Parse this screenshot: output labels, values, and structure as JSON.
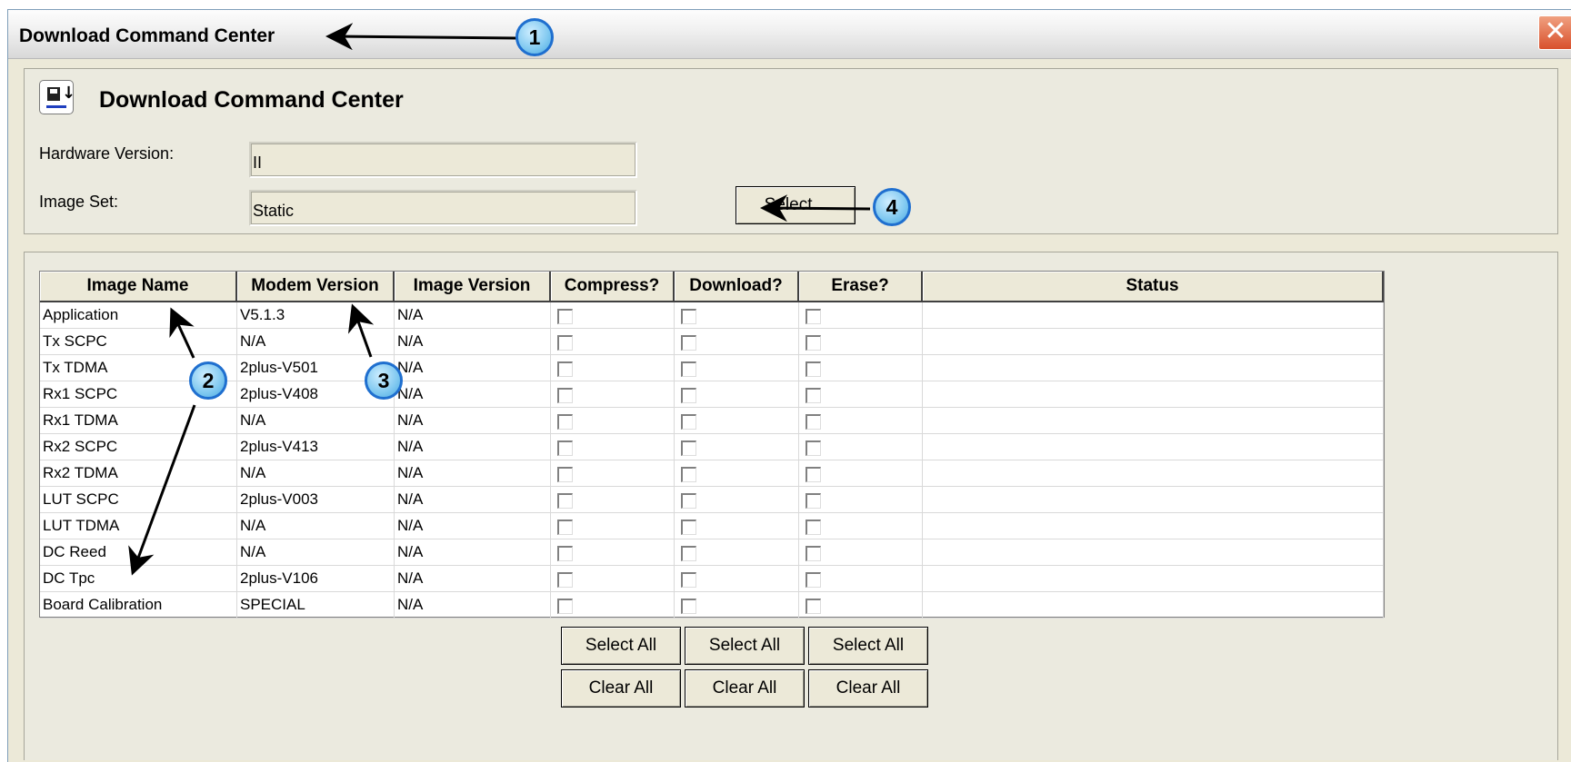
{
  "window": {
    "title": "Download Command Center",
    "close_glyph": "✕"
  },
  "header": {
    "title": "Download Command Center",
    "icon": "download-floppy-icon"
  },
  "hardware": {
    "label": "Hardware Version:",
    "value": "II"
  },
  "image_set": {
    "label": "Image Set:",
    "value": "Static",
    "select_button": "Select..."
  },
  "table": {
    "columns": [
      "Image Name",
      "Modem Version",
      "Image Version",
      "Compress?",
      "Download?",
      "Erase?",
      "Status"
    ],
    "rows": [
      {
        "name": "Application",
        "modem": "V5.1.3",
        "image": "N/A",
        "status": ""
      },
      {
        "name": "Tx SCPC",
        "modem": "N/A",
        "image": "N/A",
        "status": ""
      },
      {
        "name": "Tx TDMA",
        "modem": "2plus-V501",
        "image": "N/A",
        "status": ""
      },
      {
        "name": "Rx1 SCPC",
        "modem": "2plus-V408",
        "image": "N/A",
        "status": ""
      },
      {
        "name": "Rx1 TDMA",
        "modem": "N/A",
        "image": "N/A",
        "status": ""
      },
      {
        "name": "Rx2 SCPC",
        "modem": "2plus-V413",
        "image": "N/A",
        "status": ""
      },
      {
        "name": "Rx2 TDMA",
        "modem": "N/A",
        "image": "N/A",
        "status": ""
      },
      {
        "name": "LUT SCPC",
        "modem": "2plus-V003",
        "image": "N/A",
        "status": ""
      },
      {
        "name": "LUT TDMA",
        "modem": "N/A",
        "image": "N/A",
        "status": ""
      },
      {
        "name": "DC Reed",
        "modem": "N/A",
        "image": "N/A",
        "status": ""
      },
      {
        "name": "DC Tpc",
        "modem": "2plus-V106",
        "image": "N/A",
        "status": ""
      },
      {
        "name": "Board Calibration",
        "modem": "SPECIAL",
        "image": "N/A",
        "status": ""
      }
    ]
  },
  "buttons": {
    "select_all": "Select All",
    "clear_all": "Clear All"
  },
  "callouts": [
    "1",
    "2",
    "3",
    "4"
  ]
}
